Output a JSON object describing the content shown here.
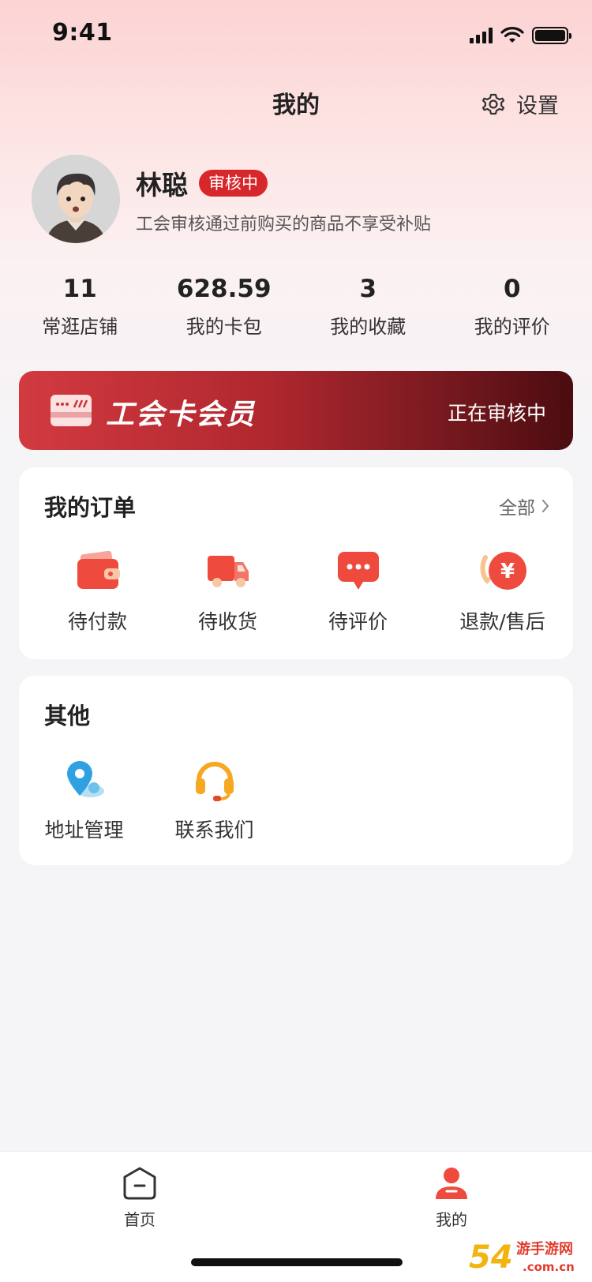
{
  "status_bar": {
    "time": "9:41"
  },
  "nav": {
    "title": "我的",
    "settings_label": "设置"
  },
  "profile": {
    "name": "林聪",
    "badge": "审核中",
    "notice": "工会审核通过前购买的商品不享受补贴"
  },
  "stats": [
    {
      "value": "11",
      "label": "常逛店铺"
    },
    {
      "value": "628.59",
      "label": "我的卡包"
    },
    {
      "value": "3",
      "label": "我的收藏"
    },
    {
      "value": "0",
      "label": "我的评价"
    }
  ],
  "banner": {
    "title": "工会卡会员",
    "status": "正在审核中"
  },
  "orders": {
    "title": "我的订单",
    "all_label": "全部",
    "items": [
      {
        "label": "待付款",
        "icon": "wallet-icon"
      },
      {
        "label": "待收货",
        "icon": "truck-icon"
      },
      {
        "label": "待评价",
        "icon": "comment-icon"
      },
      {
        "label": "退款/售后",
        "icon": "refund-icon"
      }
    ]
  },
  "others": {
    "title": "其他",
    "items": [
      {
        "label": "地址管理",
        "icon": "location-icon"
      },
      {
        "label": "联系我们",
        "icon": "headset-icon"
      }
    ]
  },
  "tabbar": {
    "home_label": "首页",
    "mine_label": "我的"
  },
  "watermark": {
    "text": "54游手游网 .com.cn"
  },
  "colors": {
    "accent": "#d8272b",
    "banner_dark": "#4b0c10",
    "background": "#f5f4f6"
  }
}
